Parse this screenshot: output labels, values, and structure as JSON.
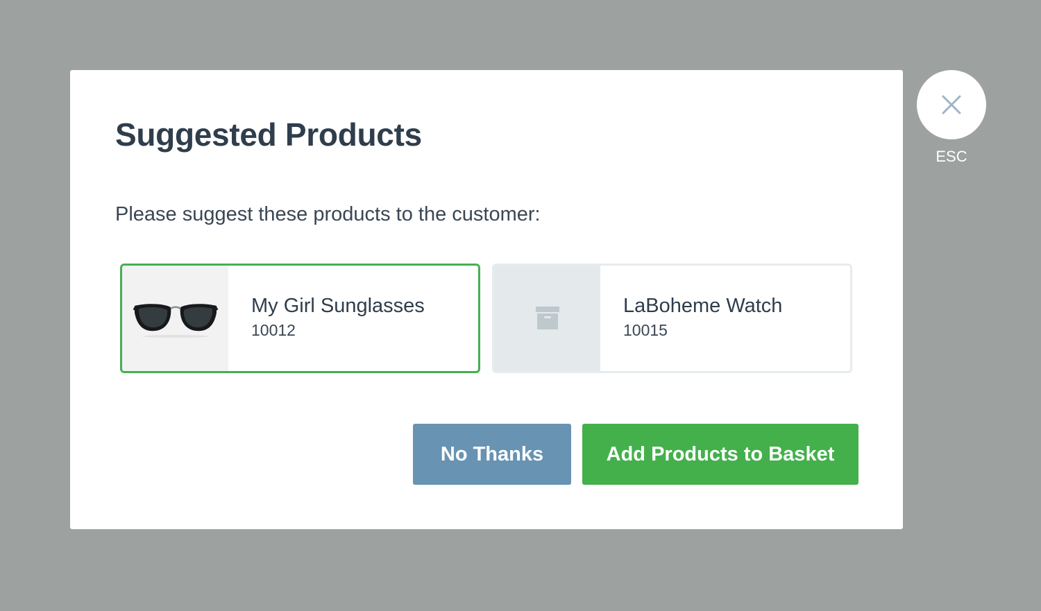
{
  "modal": {
    "title": "Suggested Products",
    "subtitle": "Please suggest these products to the customer:"
  },
  "products": [
    {
      "name": "My Girl Sunglasses",
      "sku": "10012",
      "selected": true,
      "thumbnail_icon": "sunglasses-image"
    },
    {
      "name": "LaBoheme Watch",
      "sku": "10015",
      "selected": false,
      "thumbnail_icon": "archive-box-icon"
    }
  ],
  "buttons": {
    "no_thanks": "No Thanks",
    "add_to_basket": "Add Products to Basket"
  },
  "close": {
    "icon": "close-icon",
    "label": "ESC"
  },
  "colors": {
    "overlay": "#9da1a0",
    "title_text": "#2f3d4c",
    "selected_border": "#45b052",
    "unselected_border": "#e6ebed",
    "secondary_button": "#6893b3",
    "primary_button": "#43b04c",
    "placeholder_bg": "#e4e9eb"
  }
}
